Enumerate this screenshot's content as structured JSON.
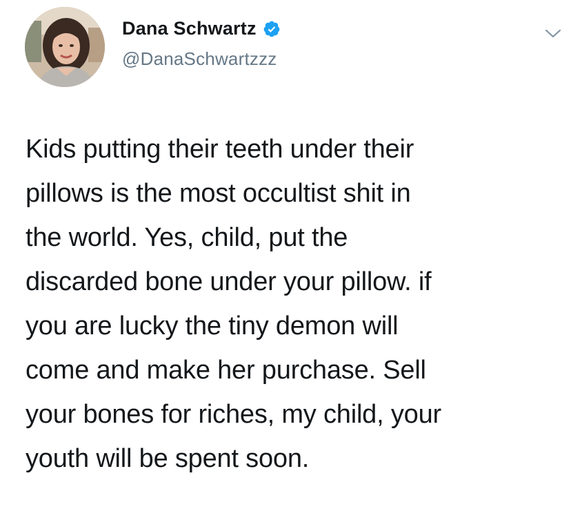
{
  "author": {
    "display_name": "Dana Schwartz",
    "handle": "@DanaSchwartzzz",
    "verified": true,
    "verified_badge_color": "#1da1f2"
  },
  "icons": {
    "verified": "verified-badge-icon",
    "menu": "chevron-down-icon"
  },
  "tweet": {
    "lines": [
      "Kids putting their teeth under their",
      "pillows is the most occultist shit in",
      "the world. Yes, child, put the",
      "discarded bone under your pillow. if",
      "you are lucky the tiny demon will",
      "come and make her purchase. Sell",
      "your bones for riches, my child, your",
      "youth will be spent soon."
    ]
  },
  "colors": {
    "text": "#14171a",
    "secondary_text": "#657786",
    "background": "#ffffff"
  }
}
